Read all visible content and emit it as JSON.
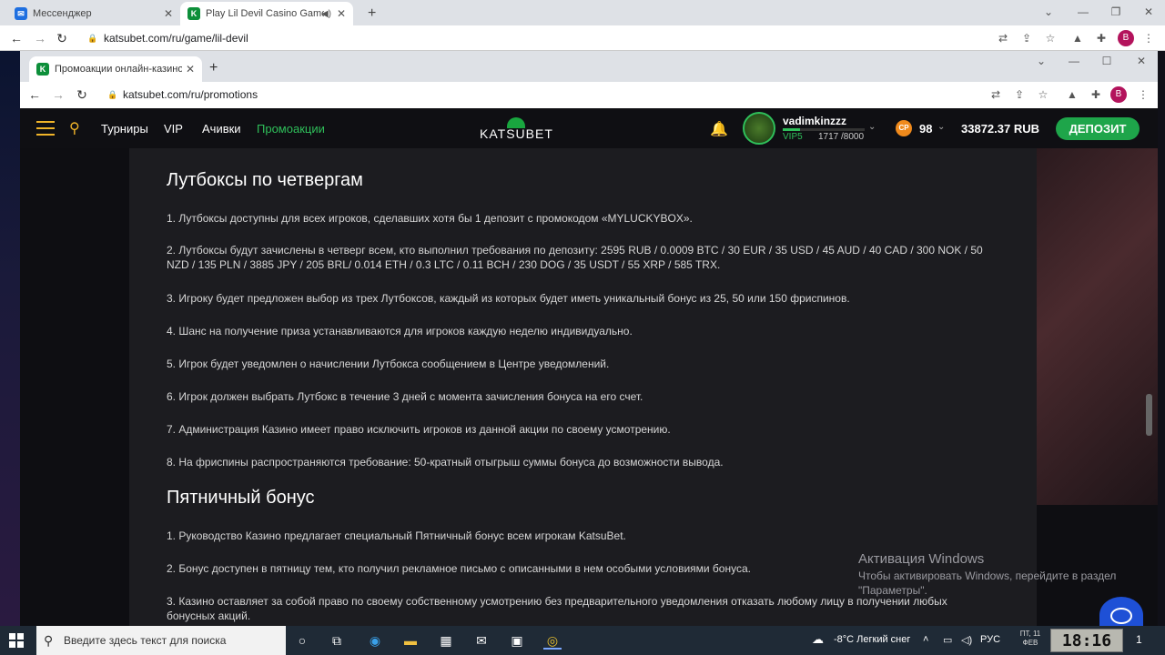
{
  "outer_browser": {
    "tabs": [
      {
        "title": "Мессенджер",
        "favicon": "messenger-icon",
        "color": "#1e6fe0"
      },
      {
        "title": "Play Lil Devil Casino Game O",
        "favicon": "K",
        "color": "#0d8f3a"
      }
    ],
    "url": "katsubet.com/ru/game/lil-devil",
    "profile_letter": "B"
  },
  "inner_browser": {
    "tab_title": "Промоакции онлайн-казино | К",
    "favicon": "K",
    "url": "katsubet.com/ru/promotions",
    "profile_letter": "B"
  },
  "site": {
    "nav": [
      "Турниры",
      "VIP",
      "Ачивки",
      "Промоакции"
    ],
    "active_nav": "Промоакции",
    "logo": "KATSUBET",
    "username": "vadimkinzzz",
    "vip": "VIP5",
    "xp": "1717 /8000",
    "xp_progress": 0.21,
    "coin_badge": "CP",
    "coins": "98",
    "balance": "33872.37 RUB",
    "deposit_label": "ДЕПОЗИТ",
    "accent": "#1ea54a"
  },
  "content": {
    "section1_title": "Лутбоксы по четвергам",
    "section1_items": [
      "1. Лутбоксы доступны для всех игроков, сделавших хотя бы 1 депозит с промокодом «MYLUCKYBOX».",
      "2. Лутбоксы будут зачислены в четверг всем, кто выполнил требования по депозиту: 2595 RUB / 0.0009 BTC / 30 EUR / 35 USD / 45 AUD / 40 CAD / 300 NOK / 50 NZD / 135 PLN / 3885 JPY / 205 BRL/ 0.014 ETH / 0.3 LTC / 0.11 BCH / 230 DOG / 35 USDT / 55 XRP / 585 TRX.",
      "3. Игроку будет предложен выбор из трех Лутбоксов, каждый из которых будет иметь уникальный бонус из 25, 50 или 150 фриспинов.",
      "4. Шанс на получение приза устанавливаются для игроков каждую неделю индивидуально.",
      "5. Игрок будет уведомлен о начислении Лутбокса сообщением в Центре уведомлений.",
      "6. Игрок должен выбрать Лутбокс в течение 3 дней с момента зачисления бонуса на его счет.",
      "7. Администрация Казино имеет право исключить игроков из данной акции по своему усмотрению.",
      "8. На фриспины распространяются требование: 50-кратный отыгрыш суммы бонуса до возможности вывода."
    ],
    "section2_title": "Пятничный бонус",
    "section2_items": [
      "1. Руководство Казино предлагает специальный Пятничный бонус всем игрокам KatsuBet.",
      "2. Бонус доступен в пятницу тем, кто получил рекламное письмо с описанными в нем особыми условиями бонуса.",
      "3. Казино оставляет за собой право по своему собственному усмотрению без предварительного уведомления отказать любому лицу в получении любых бонусных акций."
    ]
  },
  "watermark": {
    "title": "Активация Windows",
    "text": "Чтобы активировать Windows, перейдите в раздел \"Параметры\"."
  },
  "taskbar": {
    "search_placeholder": "Введите здесь текст для поиска",
    "weather": "-8°C  Легкий снег",
    "lang": "РУС",
    "date": "ПТ, 11 ФЕВ",
    "time": "18:16",
    "notif_count": "1"
  }
}
